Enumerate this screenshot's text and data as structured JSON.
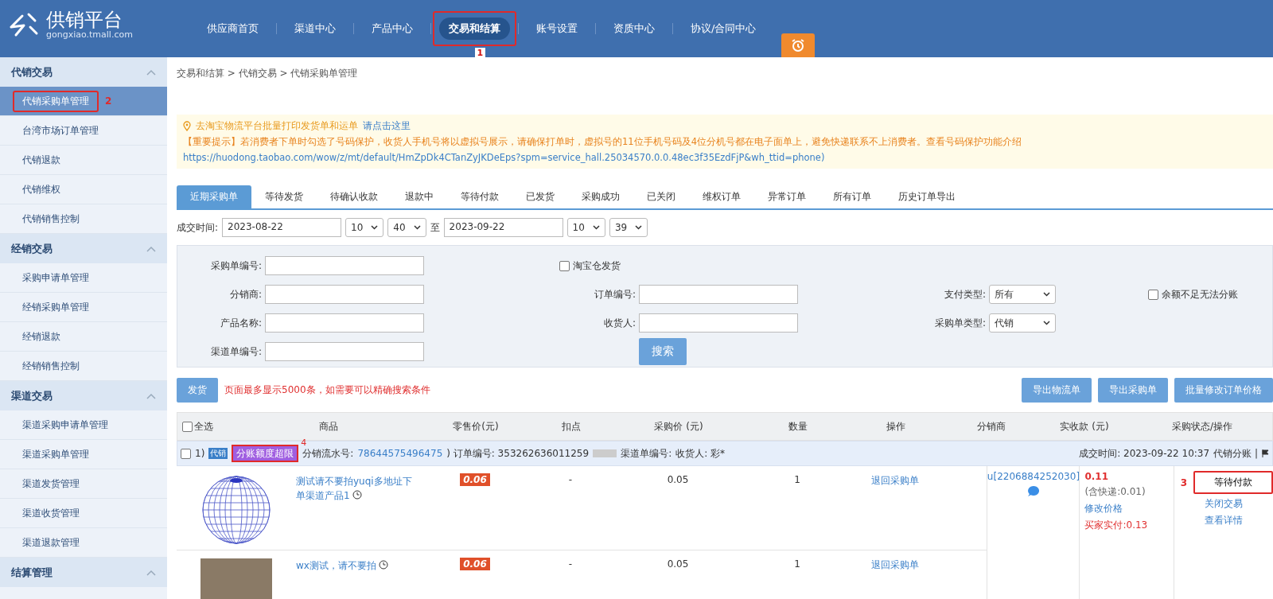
{
  "header": {
    "logo": {
      "title": "供销平台",
      "subtitle": "gongxiao.tmall.com"
    },
    "nav": [
      {
        "label": "供应商首页",
        "selected": false,
        "highlighted": false
      },
      {
        "label": "渠道中心",
        "selected": false,
        "highlighted": false
      },
      {
        "label": "产品中心",
        "selected": false,
        "highlighted": false
      },
      {
        "label": "交易和结算",
        "selected": true,
        "highlighted": true,
        "callout": "1"
      },
      {
        "label": "账号设置",
        "selected": false,
        "highlighted": false
      },
      {
        "label": "资质中心",
        "selected": false,
        "highlighted": false
      },
      {
        "label": "协议/合同中心",
        "selected": false,
        "highlighted": false
      }
    ]
  },
  "sidebar": {
    "sections": [
      {
        "title": "代销交易",
        "expanded": true,
        "items": [
          {
            "label": "代销采购单管理",
            "selected": true,
            "highlighted": true,
            "callout": "2"
          },
          {
            "label": "台湾市场订单管理",
            "selected": false,
            "highlighted": false
          },
          {
            "label": "代销退款",
            "selected": false,
            "highlighted": false
          },
          {
            "label": "代销维权",
            "selected": false,
            "highlighted": false
          },
          {
            "label": "代销销售控制",
            "selected": false,
            "highlighted": false
          }
        ]
      },
      {
        "title": "经销交易",
        "expanded": true,
        "items": [
          {
            "label": "采购申请单管理",
            "selected": false,
            "highlighted": false
          },
          {
            "label": "经销采购单管理",
            "selected": false,
            "highlighted": false
          },
          {
            "label": "经销退款",
            "selected": false,
            "highlighted": false
          },
          {
            "label": "经销销售控制",
            "selected": false,
            "highlighted": false
          }
        ]
      },
      {
        "title": "渠道交易",
        "expanded": true,
        "items": [
          {
            "label": "渠道采购申请单管理",
            "selected": false,
            "highlighted": false
          },
          {
            "label": "渠道采购单管理",
            "selected": false,
            "highlighted": false
          },
          {
            "label": "渠道发货管理",
            "selected": false,
            "highlighted": false
          },
          {
            "label": "渠道收货管理",
            "selected": false,
            "highlighted": false
          },
          {
            "label": "渠道退款管理",
            "selected": false,
            "highlighted": false
          }
        ]
      },
      {
        "title": "结算管理",
        "expanded": true
      }
    ]
  },
  "breadcrumb": "交易和结算 > 代销交易 > 代销采购单管理",
  "notice": {
    "tip": "去淘宝物流平台批量打印发货单和运单",
    "tip_link": "请点击这里",
    "important": "【重要提示】若消费者下单时勾选了号码保护，收货人手机号将以虚拟号展示，请确保打单时，虚拟号的11位手机号码及4位分机号都在电子面单上，避免快递联系不上消费者。查看号码保护功能介绍",
    "url": "https://huodong.taobao.com/wow/z/mt/default/HmZpDk4CTanZyJKDeEps?spm=service_hall.25034570.0.0.48ec3f35EzdFjP&wh_ttid=phone)"
  },
  "tabs": [
    {
      "label": "近期采购单",
      "selected": true
    },
    {
      "label": "等待发货",
      "selected": false
    },
    {
      "label": "待确认收款",
      "selected": false
    },
    {
      "label": "退款中",
      "selected": false
    },
    {
      "label": "等待付款",
      "selected": false
    },
    {
      "label": "已发货",
      "selected": false
    },
    {
      "label": "采购成功",
      "selected": false
    },
    {
      "label": "已关闭",
      "selected": false
    },
    {
      "label": "维权订单",
      "selected": false
    },
    {
      "label": "异常订单",
      "selected": false
    },
    {
      "label": "所有订单",
      "selected": false
    },
    {
      "label": "历史订单导出",
      "selected": false
    }
  ],
  "date_filter": {
    "label": "成交时间:",
    "start": "2023-08-22",
    "start_hour": "10",
    "start_minute": "40",
    "separator": "至",
    "end": "2023-09-22",
    "end_hour": "10",
    "end_minute": "39"
  },
  "search_form": {
    "cells": [
      {
        "kind": "input",
        "label": "采购单编号:"
      },
      {
        "kind": "checkbox",
        "label": "淘宝仓发货",
        "checked": false
      },
      {
        "kind": "blank"
      },
      {
        "kind": "blank"
      },
      {
        "kind": "input",
        "label": "分销商:"
      },
      {
        "kind": "input",
        "label": "订单编号:"
      },
      {
        "kind": "select",
        "label": "支付类型:",
        "value": "所有"
      },
      {
        "kind": "checkbox",
        "label": "余额不足无法分账",
        "checked": false
      },
      {
        "kind": "input",
        "label": "产品名称:"
      },
      {
        "kind": "input",
        "label": "收货人:"
      },
      {
        "kind": "select",
        "label": "采购单类型:",
        "value": "代销"
      },
      {
        "kind": "blank"
      },
      {
        "kind": "input",
        "label": "渠道单编号:"
      },
      {
        "kind": "button",
        "label": "搜索"
      }
    ]
  },
  "action_bar": {
    "ship_button": "发货",
    "warning": "页面最多显示5000条，如需要可以精确搜索条件",
    "buttons": [
      "导出物流单",
      "导出采购单",
      "批量修改订单价格"
    ]
  },
  "table": {
    "select_all": {
      "label": "全选",
      "checked": false
    },
    "columns": [
      "商品",
      "零售价(元)",
      "扣点",
      "采购价 (元)",
      "数量",
      "操作",
      "分销商",
      "实收款 (元)",
      "采购状态/操作"
    ],
    "orders": [
      {
        "checked": false,
        "index": "1)",
        "tag": "代销",
        "badge": {
          "label": "分账额度超限",
          "highlighted": true,
          "callout": "4"
        },
        "serial_label": "分销流水号:",
        "serial": "78644575496475",
        "order_no": ") 订单编号: 353262636011259",
        "channel_label": "渠道单编号:",
        "receiver": "收货人: 彩*",
        "time": "成交时间: 2023-09-22 10:37",
        "split": "代销分账 |",
        "items": [
          {
            "kind": "globe",
            "name": "测试请不要拍yuqi多地址下单渠道产品1",
            "retail": "0.06",
            "discount": "-",
            "price": "0.05",
            "quantity": "1",
            "action": "退回采购单"
          },
          {
            "kind": "photo",
            "name": "wx测试，请不要拍",
            "retail": "0.06",
            "discount": "-",
            "price": "0.05",
            "quantity": "1",
            "action": "退回采购单"
          }
        ],
        "distributor": "u[2206884252030]",
        "amount": "0.11",
        "shipping": "(含快递:0.01)",
        "edit_price": "修改价格",
        "buyer_paid": "买家实付:0.13",
        "status": {
          "label": "等待付款",
          "highlighted": true,
          "callout": "3"
        },
        "links": [
          "关闭交易",
          "查看详情"
        ]
      }
    ]
  }
}
